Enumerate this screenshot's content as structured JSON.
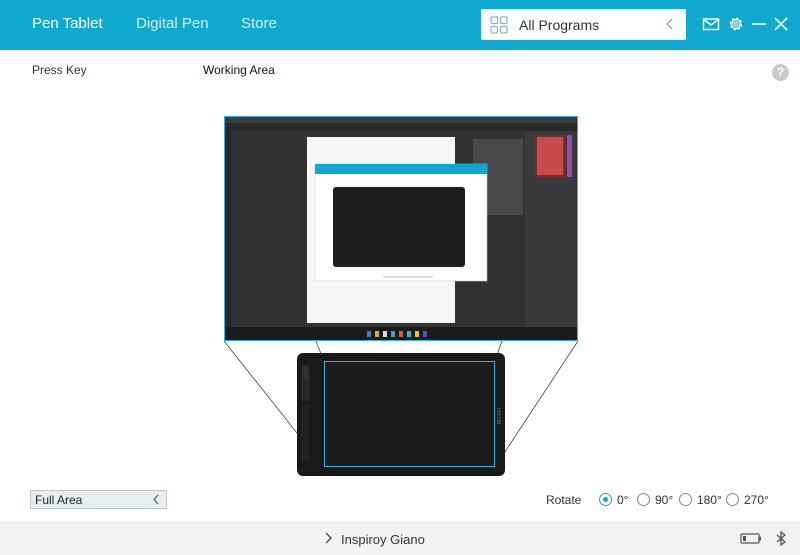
{
  "header": {
    "tabs": [
      {
        "label": "Pen Tablet",
        "active": true
      },
      {
        "label": "Digital Pen",
        "active": false
      },
      {
        "label": "Store",
        "active": false
      }
    ],
    "program_select": {
      "value": "All Programs",
      "icon": "grid-icon"
    },
    "icons": [
      "mail-icon",
      "gear-icon",
      "minimize-icon",
      "close-icon"
    ]
  },
  "subheader": {
    "press_key": "Press Key",
    "working_area": "Working Area",
    "help": "?"
  },
  "mapping": {
    "screen": "desktop-screenshot",
    "tablet": "pen-tablet"
  },
  "controls": {
    "area_select": "Full Area",
    "rotate_label": "Rotate",
    "rotate_options": [
      "0°",
      "90°",
      "180°",
      "270°"
    ],
    "rotate_selected": "0°"
  },
  "footer": {
    "device_name": "Inspiroy Giano"
  },
  "colors": {
    "accent": "#0fa9cf",
    "area_outline": "#2ab7dc"
  }
}
